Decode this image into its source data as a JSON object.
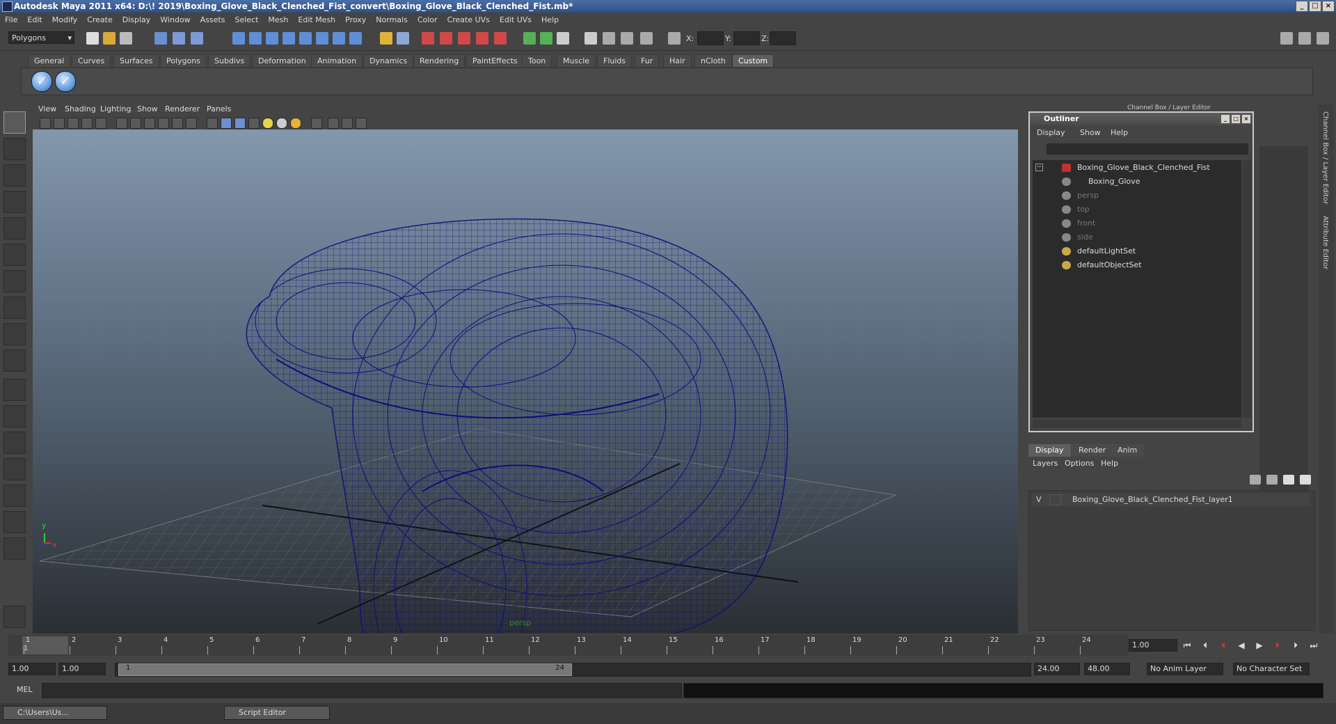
{
  "window": {
    "title": "Autodesk Maya 2011 x64: D:\\! 2019\\Boxing_Glove_Black_Clenched_Fist_convert\\Boxing_Glove_Black_Clenched_Fist.mb*"
  },
  "menubar": [
    "File",
    "Edit",
    "Modify",
    "Create",
    "Display",
    "Window",
    "Assets",
    "Select",
    "Mesh",
    "Edit Mesh",
    "Proxy",
    "Normals",
    "Color",
    "Create UVs",
    "Edit UVs",
    "Help"
  ],
  "statusline": {
    "mode": "Polygons",
    "x_label": "X:",
    "y_label": "Y:",
    "z_label": "Z:"
  },
  "shelf": {
    "tabs": [
      "General",
      "Curves",
      "Surfaces",
      "Polygons",
      "Subdivs",
      "Deformation",
      "Animation",
      "Dynamics",
      "Rendering",
      "PaintEffects",
      "Toon",
      "Muscle",
      "Fluids",
      "Fur",
      "Hair",
      "nCloth",
      "Custom"
    ],
    "active_tab": "Custom"
  },
  "viewport": {
    "menu": [
      "View",
      "Shading",
      "Lighting",
      "Show",
      "Renderer",
      "Panels"
    ],
    "camera": "persp",
    "axis_y": "y",
    "axis_x": "x",
    "wire_color": "#0d0d7a"
  },
  "outliner": {
    "title": "Outliner",
    "menu": [
      "Display",
      "Show",
      "Help"
    ],
    "items": [
      {
        "label": "Boxing_Glove_Black_Clenched_Fist",
        "icon": "transform-icon",
        "dim": false
      },
      {
        "label": "Boxing_Glove",
        "icon": "mesh-icon",
        "dim": false
      },
      {
        "label": "persp",
        "icon": "camera-icon",
        "dim": true
      },
      {
        "label": "top",
        "icon": "camera-icon",
        "dim": true
      },
      {
        "label": "front",
        "icon": "camera-icon",
        "dim": true
      },
      {
        "label": "side",
        "icon": "camera-icon",
        "dim": true
      },
      {
        "label": "defaultLightSet",
        "icon": "set-icon",
        "dim": false
      },
      {
        "label": "defaultObjectSet",
        "icon": "set-icon",
        "dim": false
      }
    ]
  },
  "channelbox": {
    "label": "Channel Box / Layer Editor"
  },
  "side_tabs": {
    "channel": "Channel Box / Layer Editor",
    "attribute": "Attribute Editor"
  },
  "layers": {
    "tabs": [
      "Display",
      "Render",
      "Anim"
    ],
    "active_tab": "Display",
    "menu": [
      "Layers",
      "Options",
      "Help"
    ],
    "rows": [
      {
        "visible": "V",
        "name": "Boxing_Glove_Black_Clenched_Fist_layer1"
      }
    ]
  },
  "timeline": {
    "frames": [
      "1",
      "2",
      "3",
      "4",
      "5",
      "6",
      "7",
      "8",
      "9",
      "10",
      "11",
      "12",
      "13",
      "14",
      "15",
      "16",
      "17",
      "18",
      "19",
      "20",
      "21",
      "22",
      "23",
      "24"
    ],
    "current_marker": "1",
    "current_frame": "1.00"
  },
  "range": {
    "start": "1.00",
    "anim_start": "1.00",
    "range_start": "1",
    "range_end": "24",
    "anim_end": "24.00",
    "end": "48.00",
    "anim_layer": "No Anim Layer",
    "char_set": "No Character Set"
  },
  "cmdline": {
    "label": "MEL"
  },
  "taskbar": [
    {
      "label": "C:\\Users\\Us..."
    },
    {
      "label": "Script Editor"
    }
  ]
}
